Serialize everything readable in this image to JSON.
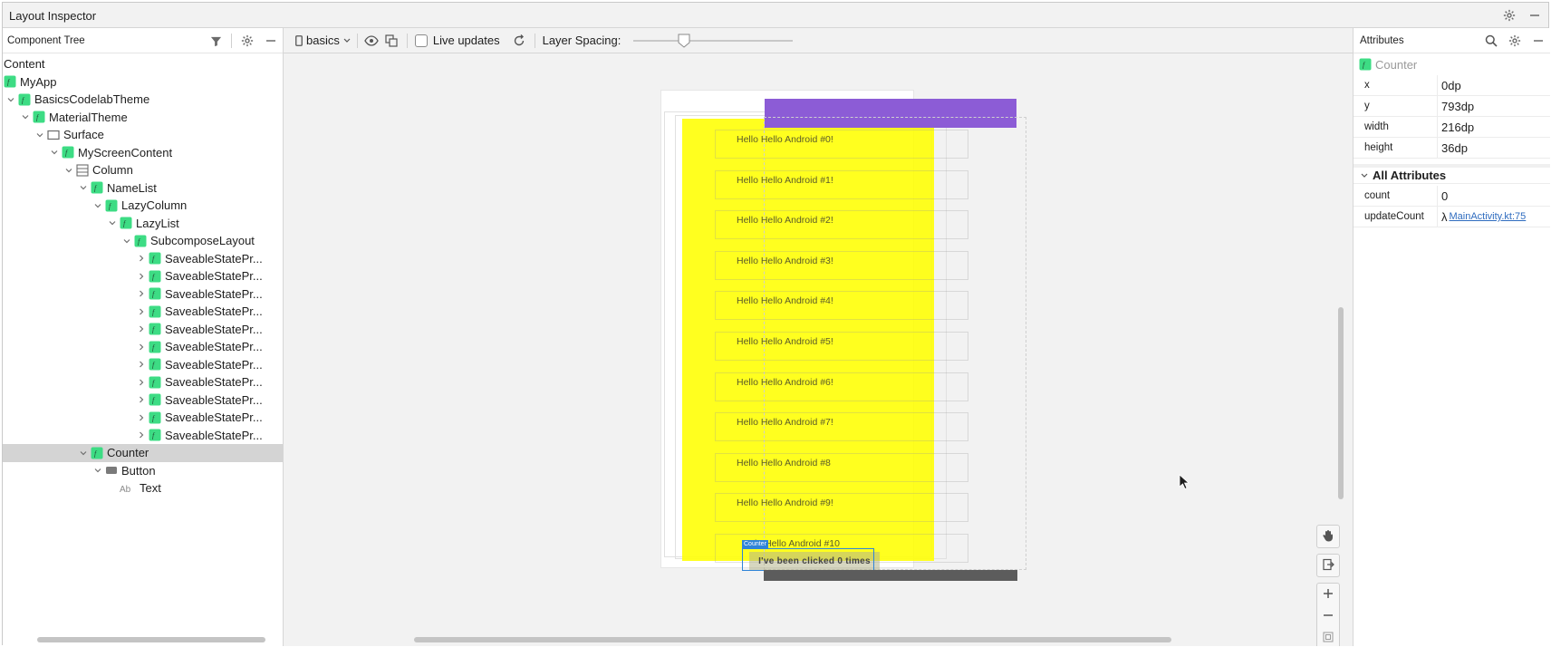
{
  "window": {
    "title": "Layout Inspector"
  },
  "component_tree": {
    "title": "Component Tree",
    "root_label": "Content",
    "nodes": [
      {
        "label": "MyApp",
        "indent": 0,
        "chevron": "none",
        "icon": "compose"
      },
      {
        "label": "BasicsCodelabTheme",
        "indent": 0,
        "chevron": "down",
        "icon": "compose"
      },
      {
        "label": "MaterialTheme",
        "indent": 1,
        "chevron": "down",
        "icon": "compose"
      },
      {
        "label": "Surface",
        "indent": 2,
        "chevron": "down",
        "icon": "surface"
      },
      {
        "label": "MyScreenContent",
        "indent": 3,
        "chevron": "down",
        "icon": "compose"
      },
      {
        "label": "Column",
        "indent": 4,
        "chevron": "down",
        "icon": "column"
      },
      {
        "label": "NameList",
        "indent": 5,
        "chevron": "down",
        "icon": "compose"
      },
      {
        "label": "LazyColumn",
        "indent": 6,
        "chevron": "down",
        "icon": "compose"
      },
      {
        "label": "LazyList",
        "indent": 7,
        "chevron": "down",
        "icon": "compose"
      },
      {
        "label": "SubcomposeLayout",
        "indent": 8,
        "chevron": "down",
        "icon": "compose"
      },
      {
        "label": "SaveableStatePr...",
        "indent": 9,
        "chevron": "right",
        "icon": "compose"
      },
      {
        "label": "SaveableStatePr...",
        "indent": 9,
        "chevron": "right",
        "icon": "compose"
      },
      {
        "label": "SaveableStatePr...",
        "indent": 9,
        "chevron": "right",
        "icon": "compose"
      },
      {
        "label": "SaveableStatePr...",
        "indent": 9,
        "chevron": "right",
        "icon": "compose"
      },
      {
        "label": "SaveableStatePr...",
        "indent": 9,
        "chevron": "right",
        "icon": "compose"
      },
      {
        "label": "SaveableStatePr...",
        "indent": 9,
        "chevron": "right",
        "icon": "compose"
      },
      {
        "label": "SaveableStatePr...",
        "indent": 9,
        "chevron": "right",
        "icon": "compose"
      },
      {
        "label": "SaveableStatePr...",
        "indent": 9,
        "chevron": "right",
        "icon": "compose"
      },
      {
        "label": "SaveableStatePr...",
        "indent": 9,
        "chevron": "right",
        "icon": "compose"
      },
      {
        "label": "SaveableStatePr...",
        "indent": 9,
        "chevron": "right",
        "icon": "compose"
      },
      {
        "label": "SaveableStatePr...",
        "indent": 9,
        "chevron": "right",
        "icon": "compose"
      },
      {
        "label": "Counter",
        "indent": 5,
        "chevron": "down",
        "icon": "compose",
        "selected": true
      },
      {
        "label": "Button",
        "indent": 6,
        "chevron": "down",
        "icon": "button"
      },
      {
        "label": "Text",
        "indent": 7,
        "chevron": "none",
        "icon": "text"
      }
    ]
  },
  "toolbar": {
    "device_label": "basics",
    "live_updates_label": "Live updates",
    "live_updates_checked": false,
    "layer_spacing_label": "Layer Spacing:",
    "layer_spacing_value": 0.3
  },
  "canvas": {
    "list_items": [
      "Hello Hello Android #0!",
      "Hello Hello Android #1!",
      "Hello Hello Android #2!",
      "Hello Hello Android #3!",
      "Hello Hello Android #4!",
      "Hello Hello Android #5!",
      "Hello Hello Android #6!",
      "Hello Hello Android #7!",
      "Hello Hello Android #8",
      "Hello Hello Android #9!",
      "lo Hello Android #10"
    ],
    "counter_tag": "Counter",
    "button_text": "I've been clicked 0 times"
  },
  "attributes": {
    "title": "Attributes",
    "node_name": "Counter",
    "layout": [
      {
        "key": "x",
        "value": "0dp"
      },
      {
        "key": "y",
        "value": "793dp"
      },
      {
        "key": "width",
        "value": "216dp"
      },
      {
        "key": "height",
        "value": "36dp"
      }
    ],
    "all_attributes_label": "All Attributes",
    "count_key": "count",
    "count_value": "0",
    "update_key": "updateCount",
    "update_lambda": "λ",
    "update_link": "MainActivity.kt:75"
  },
  "colors": {
    "overlay_yellow": "#ffff00",
    "top_bar_purple": "#8c5cd6",
    "selection_blue": "#2f84d8",
    "compose_icon_green": "#3ddc84"
  }
}
